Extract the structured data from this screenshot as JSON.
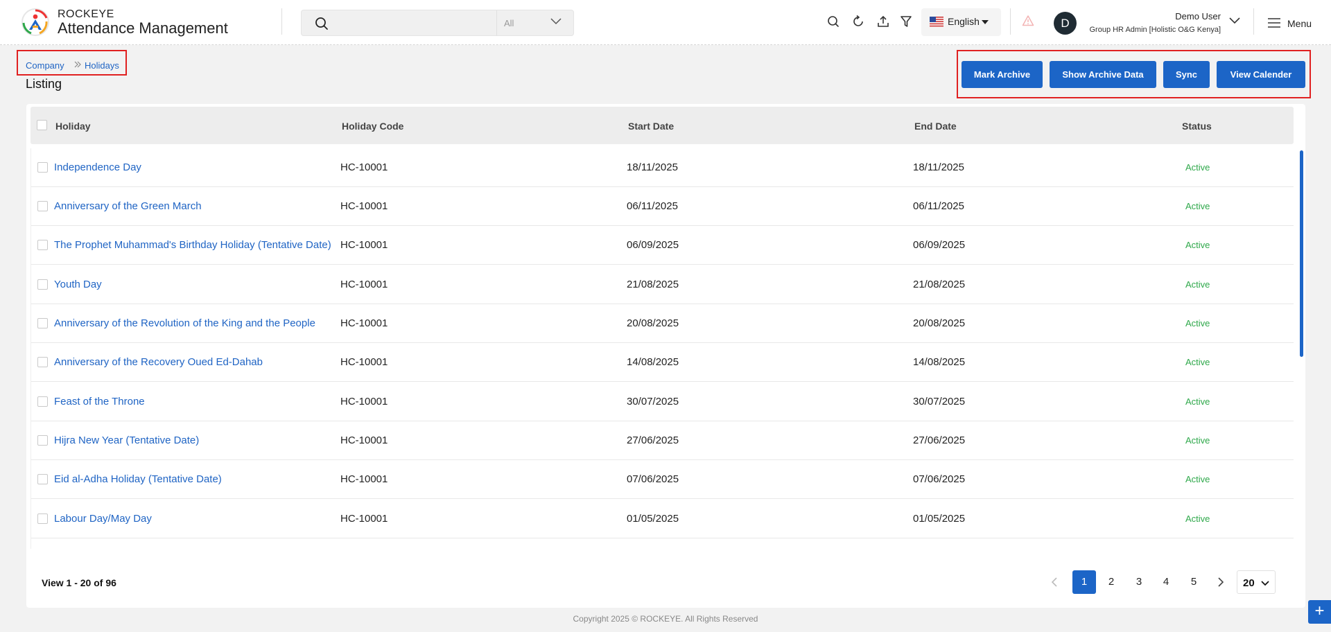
{
  "header": {
    "brand_small": "ROCKEYE",
    "brand_large": "Attendance Management",
    "search_placeholder": "",
    "search_scope": "All",
    "language": "English",
    "user_name": "Demo User",
    "user_role": "Group HR Admin [Holistic O&G Kenya]",
    "avatar_initial": "D",
    "menu_label": "Menu"
  },
  "breadcrumb": {
    "items": [
      "Company",
      "Holidays"
    ]
  },
  "page_title": "Listing",
  "actions": {
    "mark_archive": "Mark Archive",
    "show_archive": "Show Archive Data",
    "sync": "Sync",
    "view_calendar": "View Calender"
  },
  "table": {
    "columns": [
      "Holiday",
      "Holiday Code",
      "Start Date",
      "End Date",
      "Status"
    ],
    "rows": [
      {
        "holiday": "Independence Day",
        "code": "HC-10001",
        "start": "18/11/2025",
        "end": "18/11/2025",
        "status": "Active"
      },
      {
        "holiday": "Anniversary of the Green March",
        "code": "HC-10001",
        "start": "06/11/2025",
        "end": "06/11/2025",
        "status": "Active"
      },
      {
        "holiday": "The Prophet Muhammad's Birthday Holiday (Tentative Date)",
        "code": "HC-10001",
        "start": "06/09/2025",
        "end": "06/09/2025",
        "status": "Active"
      },
      {
        "holiday": "Youth Day",
        "code": "HC-10001",
        "start": "21/08/2025",
        "end": "21/08/2025",
        "status": "Active"
      },
      {
        "holiday": "Anniversary of the Revolution of the King and the People",
        "code": "HC-10001",
        "start": "20/08/2025",
        "end": "20/08/2025",
        "status": "Active"
      },
      {
        "holiday": "Anniversary of the Recovery Oued Ed-Dahab",
        "code": "HC-10001",
        "start": "14/08/2025",
        "end": "14/08/2025",
        "status": "Active"
      },
      {
        "holiday": "Feast of the Throne",
        "code": "HC-10001",
        "start": "30/07/2025",
        "end": "30/07/2025",
        "status": "Active"
      },
      {
        "holiday": "Hijra New Year (Tentative Date)",
        "code": "HC-10001",
        "start": "27/06/2025",
        "end": "27/06/2025",
        "status": "Active"
      },
      {
        "holiday": "Eid al-Adha Holiday (Tentative Date)",
        "code": "HC-10001",
        "start": "07/06/2025",
        "end": "07/06/2025",
        "status": "Active"
      },
      {
        "holiday": "Labour Day/May Day",
        "code": "HC-10001",
        "start": "01/05/2025",
        "end": "01/05/2025",
        "status": "Active"
      }
    ]
  },
  "pagination": {
    "summary": "View 1 - 20 of 96",
    "pages": [
      "1",
      "2",
      "3",
      "4",
      "5"
    ],
    "current": "1",
    "per_page": "20"
  },
  "footer": {
    "copyright": "Copyright 2025 © ROCKEYE. All Rights Reserved"
  },
  "colors": {
    "primary": "#1c65c7",
    "link": "#1f64c4",
    "active_status": "#2ea84a",
    "highlight_border": "#e02020"
  }
}
